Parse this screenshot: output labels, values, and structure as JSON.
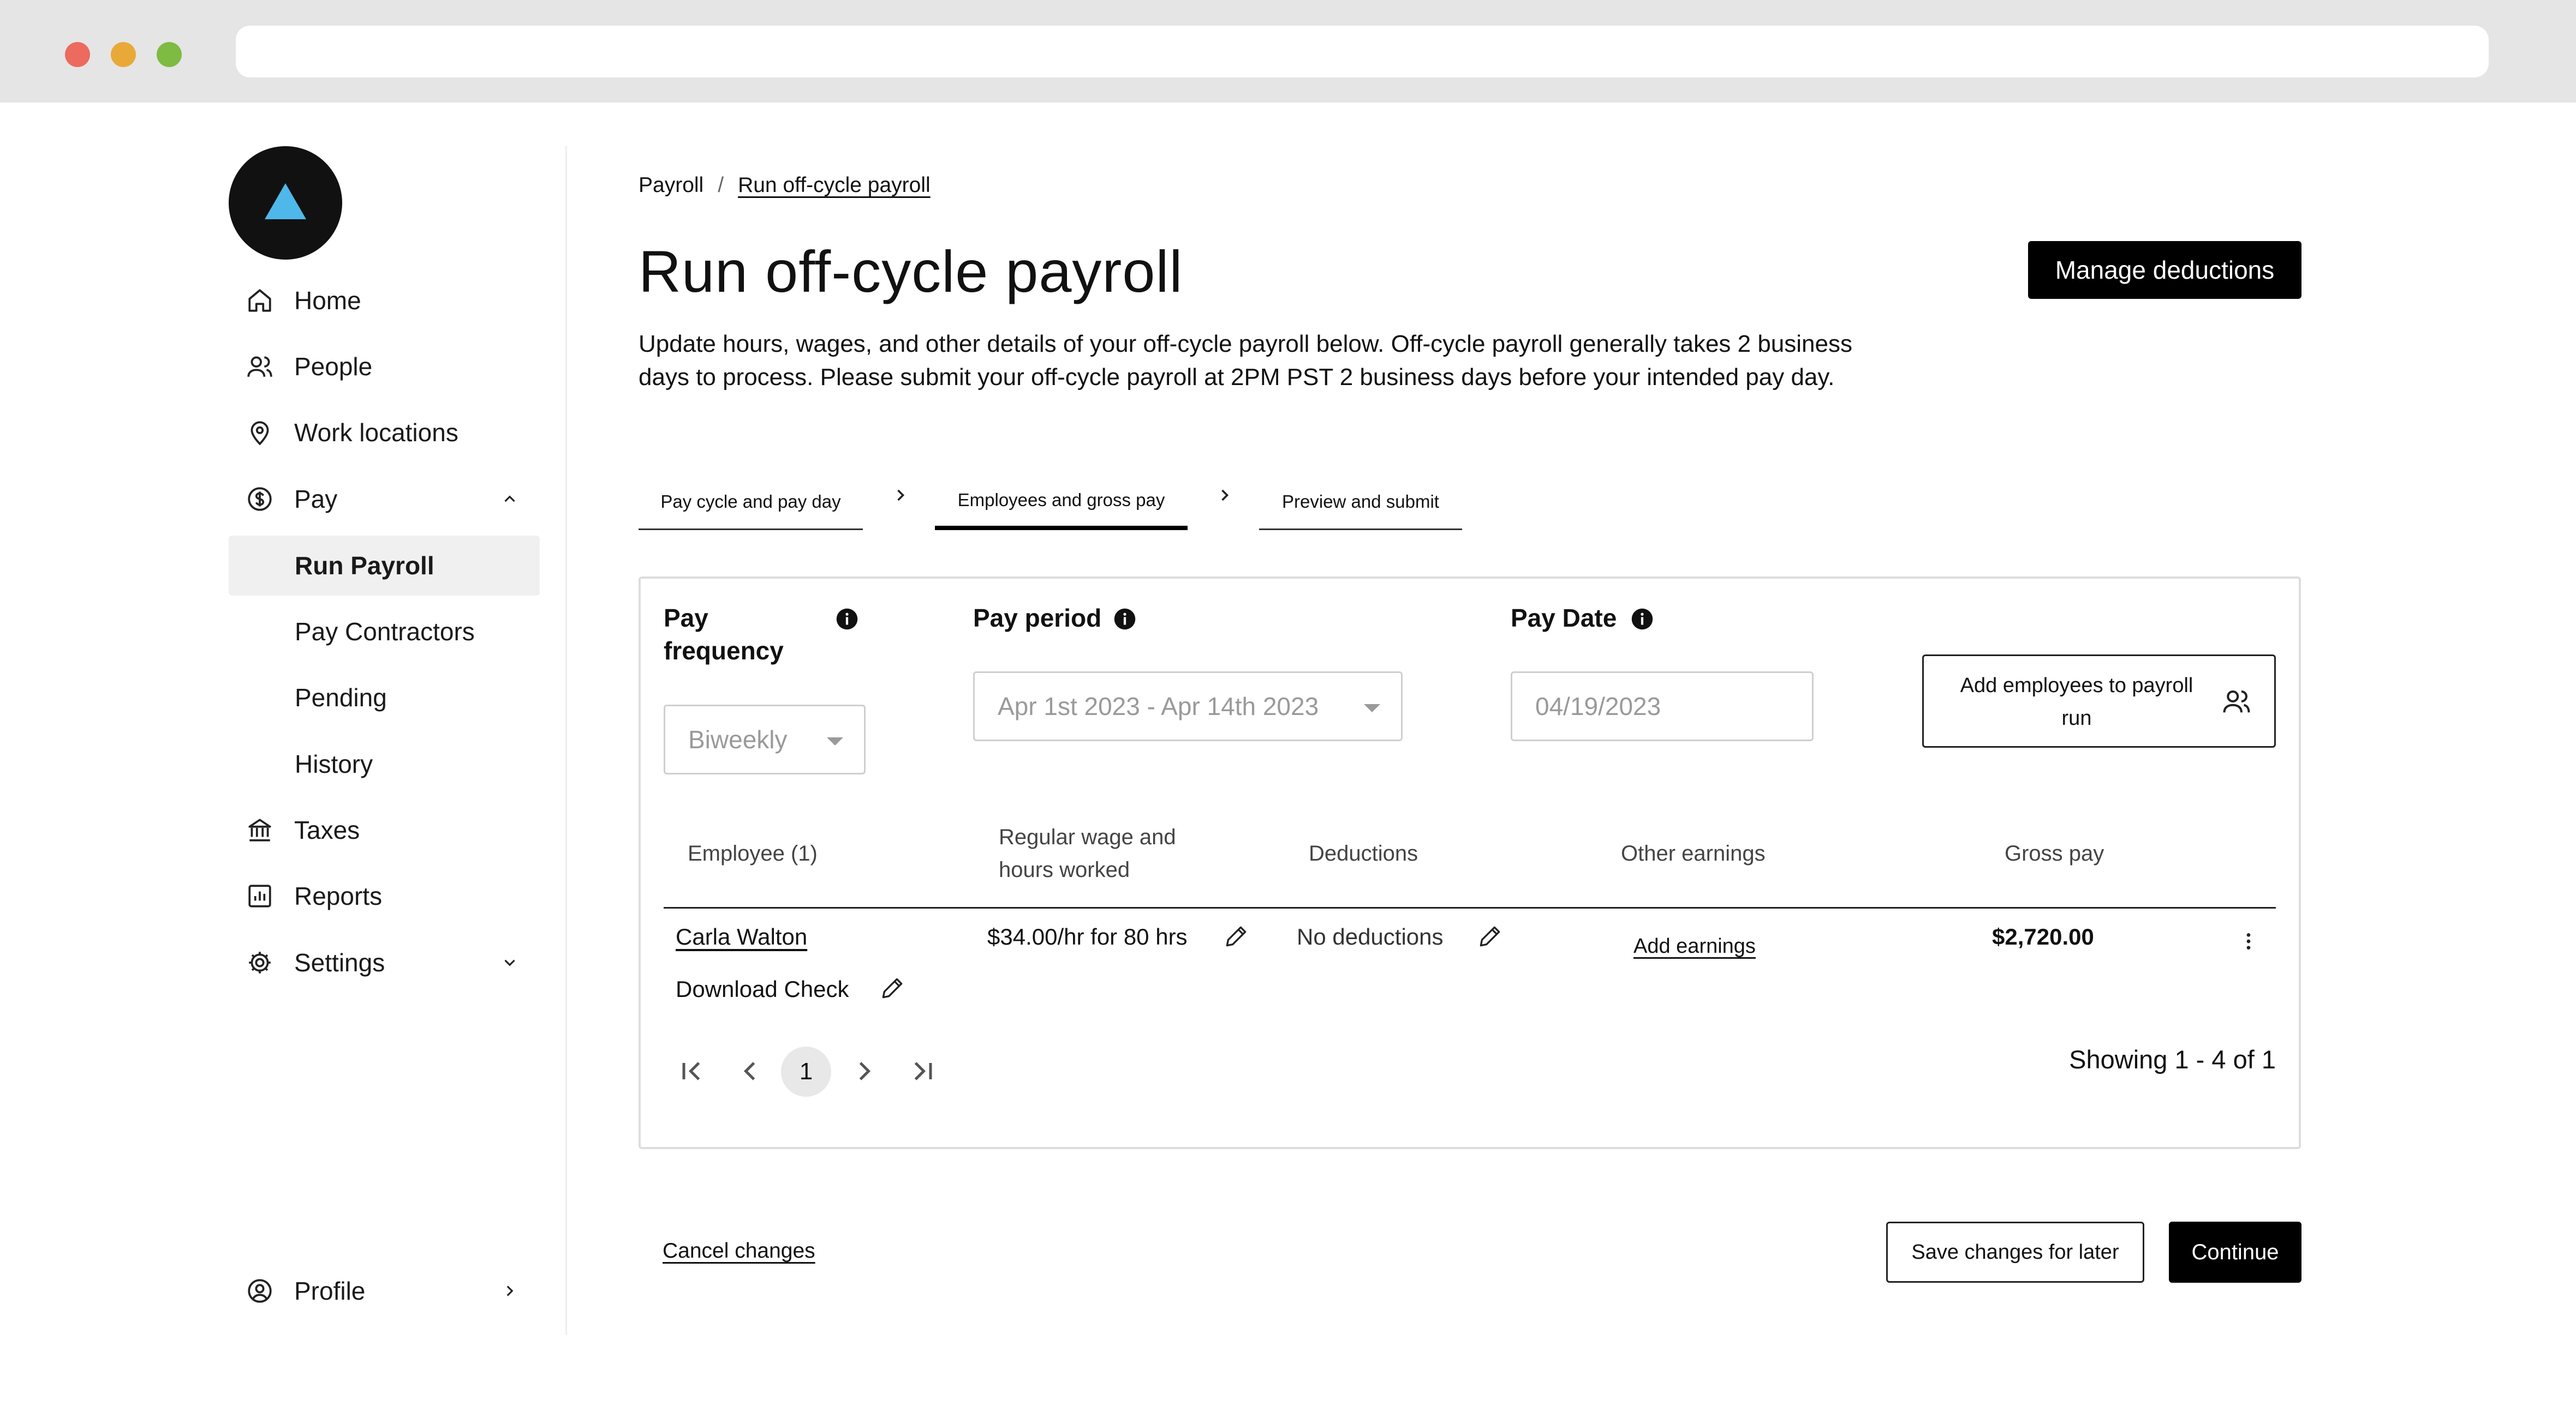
{
  "sidebar": {
    "nav": {
      "home": "Home",
      "people": "People",
      "work_locations": "Work locations",
      "pay": "Pay",
      "taxes": "Taxes",
      "reports": "Reports",
      "settings": "Settings",
      "profile": "Profile"
    },
    "pay_sub": {
      "run_payroll": "Run Payroll",
      "pay_contractors": "Pay Contractors",
      "pending": "Pending",
      "history": "History"
    }
  },
  "breadcrumb": {
    "parent": "Payroll",
    "separator": "/",
    "current": "Run off-cycle payroll"
  },
  "header": {
    "title": "Run off-cycle payroll",
    "manage_button": "Manage deductions",
    "description": "Update hours, wages, and other details of your off-cycle payroll below. Off-cycle payroll generally takes 2 business days to process. Please submit your off-cycle payroll at 2PM PST 2 business days before your intended pay day."
  },
  "steps": [
    {
      "label": "Pay cycle and pay day"
    },
    {
      "label": "Employees and gross pay"
    },
    {
      "label": "Preview and submit"
    }
  ],
  "fields": {
    "pay_frequency": {
      "label": "Pay frequency",
      "value": "Biweekly"
    },
    "pay_period": {
      "label": "Pay period",
      "value": "Apr 1st 2023 - Apr 14th 2023"
    },
    "pay_date": {
      "label": "Pay Date",
      "value": "04/19/2023"
    },
    "add_employees_button": "Add employees to payroll run"
  },
  "table": {
    "headers": {
      "employee": "Employee (1)",
      "wage": "Regular wage and hours worked",
      "deductions": "Deductions",
      "other_earnings": "Other earnings",
      "gross_pay": "Gross pay"
    },
    "rows": [
      {
        "employee": "Carla Walton",
        "download": "Download Check",
        "wage": "$34.00/hr for 80 hrs",
        "deductions": "No deductions",
        "other_earnings": "Add earnings",
        "gross_pay": "$2,720.00"
      }
    ]
  },
  "pagination": {
    "current": "1",
    "showing": "Showing 1 - 4 of 1"
  },
  "footer": {
    "cancel": "Cancel changes",
    "save": "Save changes for later",
    "continue": "Continue"
  },
  "colors": {
    "logo_bg": "#111111",
    "logo_triangle": "#4fb8ea",
    "dot_red": "#ec6a5e",
    "dot_yellow": "#e9a939",
    "dot_green": "#7dbb43",
    "primary_button": "#000000"
  }
}
